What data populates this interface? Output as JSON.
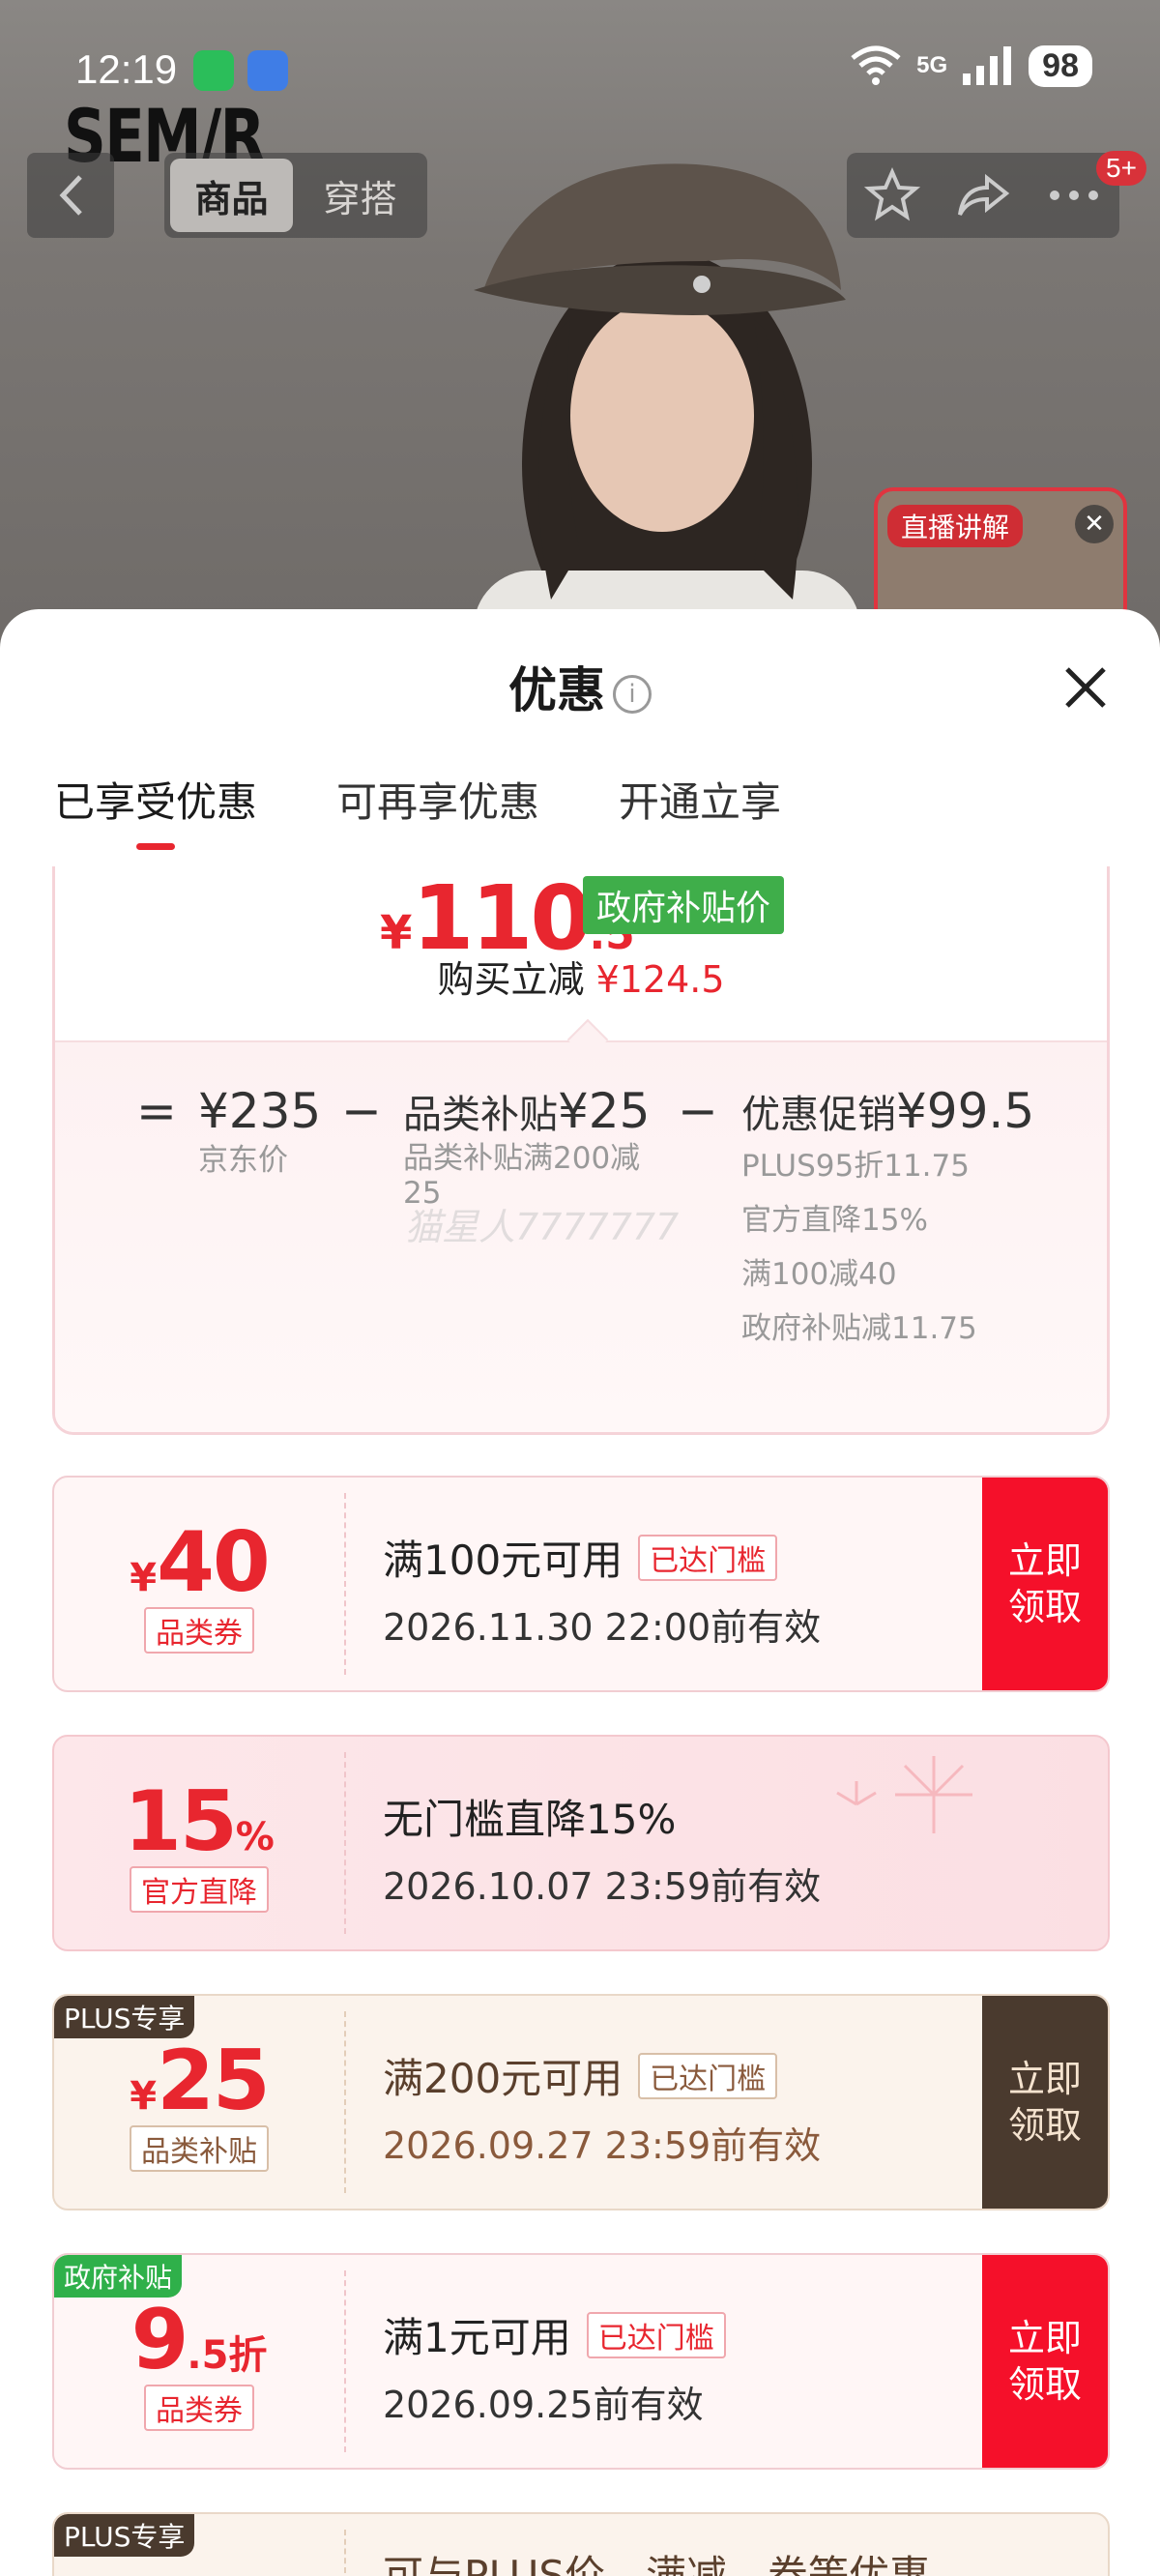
{
  "status_bar": {
    "time": "12:19",
    "network": "5G",
    "battery": "98"
  },
  "header": {
    "brand": "SEM/R",
    "tabs": [
      {
        "label": "商品"
      },
      {
        "label": "穿搭"
      }
    ],
    "badge": "5+",
    "live_label": "直播讲解"
  },
  "sheet": {
    "title": "优惠",
    "tabs": [
      {
        "label": "已享受优惠"
      },
      {
        "label": "可再享优惠"
      },
      {
        "label": "开通立享"
      }
    ]
  },
  "summary": {
    "price_yen": "¥",
    "price_int": "110",
    "price_dec": ".5",
    "price_tag": "政府补贴价",
    "reduce_label": "购买立减",
    "reduce_value": "¥124.5",
    "jd_price": "¥235",
    "jd_price_label": "京东价",
    "category_title": "品类补贴",
    "category_value": "¥25",
    "category_sub": "品类补贴满200减",
    "category_sub2": "25",
    "promo_title": "优惠促销",
    "promo_value": "¥99.5",
    "promo_items": [
      "PLUS95折11.75",
      "官方直降15%",
      "满100减40",
      "政府补贴减11.75"
    ],
    "watermark": "猫星人7777777",
    "op_equal": "=",
    "op_minus": "−"
  },
  "coupons": [
    {
      "value_prefix": "¥",
      "value": "40",
      "value_suffix": "",
      "kind": "品类券",
      "condition": "满100元可用",
      "reached": "已达门槛",
      "validity": "2026.11.30 22:00前有效",
      "button": "立即领取",
      "tag": ""
    },
    {
      "value_prefix": "",
      "value": "15",
      "value_suffix": "%",
      "kind": "官方直降",
      "condition": "无门槛直降15%",
      "reached": "",
      "validity": "2026.10.07 23:59前有效",
      "button": "",
      "tag": ""
    },
    {
      "value_prefix": "¥",
      "value": "25",
      "value_suffix": "",
      "kind": "品类补贴",
      "condition": "满200元可用",
      "reached": "已达门槛",
      "validity": "2026.09.27 23:59前有效",
      "button": "立即领取",
      "tag": "PLUS专享"
    },
    {
      "value_prefix": "",
      "value": "9",
      "value_suffix": ".5折",
      "kind": "品类券",
      "condition": "满1元可用",
      "reached": "已达门槛",
      "validity": "2026.09.25前有效",
      "button": "立即领取",
      "tag": "政府补贴"
    },
    {
      "condition": "可与PLUS价、满减、券等优惠",
      "tag": "PLUS专享"
    }
  ],
  "colors": {
    "accent": "#e8262f",
    "gov_green": "#3fae4a",
    "plus_brown": "#4a3a2e"
  }
}
